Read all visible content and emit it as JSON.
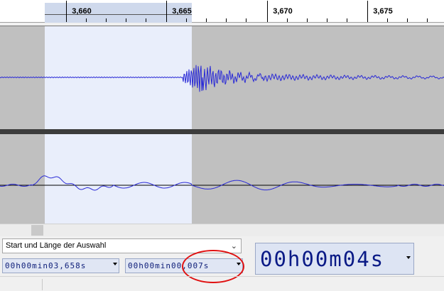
{
  "ruler": {
    "ticks": [
      "3,660",
      "3,665",
      "3,670",
      "3,675"
    ]
  },
  "selection_toolbar": {
    "mode_label": "Start und Länge der Auswahl",
    "start_value": "00h00min03,658s",
    "length_value": "00h00min00,007s"
  },
  "audio_position": {
    "value": "00h00m04s"
  },
  "colors": {
    "waveform": "#2a2ad6",
    "selection": "#e9eefb",
    "track_background": "#c0c0c0",
    "annotation": "#e01010"
  },
  "icons": {
    "dropdown": "chevron-down-icon",
    "field_menu": "triangle-down-icon"
  }
}
